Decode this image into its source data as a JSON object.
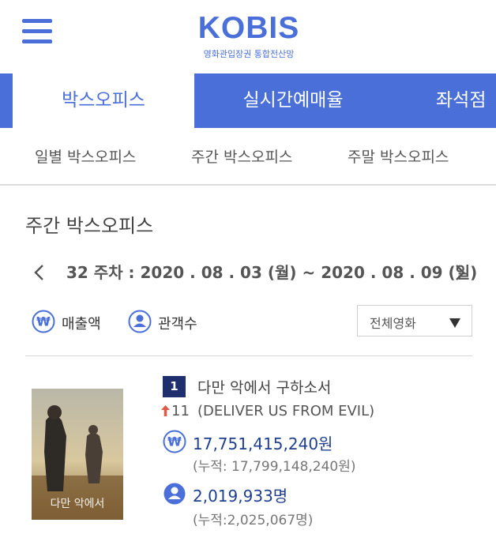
{
  "colors": {
    "brand": "#4a6fd8",
    "rank_badge": "#1f2f6e",
    "value_text": "#1f3f8f",
    "up_arrow": "#e05a4a"
  },
  "header": {
    "menu_icon": "hamburger-menu-icon",
    "logo_title": "KOBIS",
    "logo_subtitle": "영화관입장권 통합전산망"
  },
  "main_tabs": [
    {
      "label": "박스오피스",
      "active": true
    },
    {
      "label": "실시간예매율",
      "active": false
    },
    {
      "label": "좌석점",
      "active": false
    }
  ],
  "sub_tabs": [
    {
      "label": "일별 박스오피스"
    },
    {
      "label": "주간 박스오피스"
    },
    {
      "label": "주말 박스오피스"
    }
  ],
  "section_title": "주간 박스오피스",
  "week_nav": {
    "text": "32 주차 : 2020 . 08 . 03 (월) ~ 2020 . 08 . 09 (일)",
    "prev_icon": "chevron-left-icon",
    "next_icon": "chevron-right-icon"
  },
  "filters": {
    "sales_label": "매출액",
    "audience_label": "관객수",
    "select_value": "전체영화"
  },
  "movies": [
    {
      "rank": "1",
      "title_ko": "다만 악에서 구하소서",
      "rank_change": "11",
      "rank_change_direction": "up",
      "title_en": "(DELIVER US FROM EVIL)",
      "sales": "17,751,415,240원",
      "sales_cumulative": "(누적: 17,799,148,240원)",
      "audience": "2,019,933명",
      "audience_cumulative": "(누적:2,025,067명)"
    }
  ]
}
